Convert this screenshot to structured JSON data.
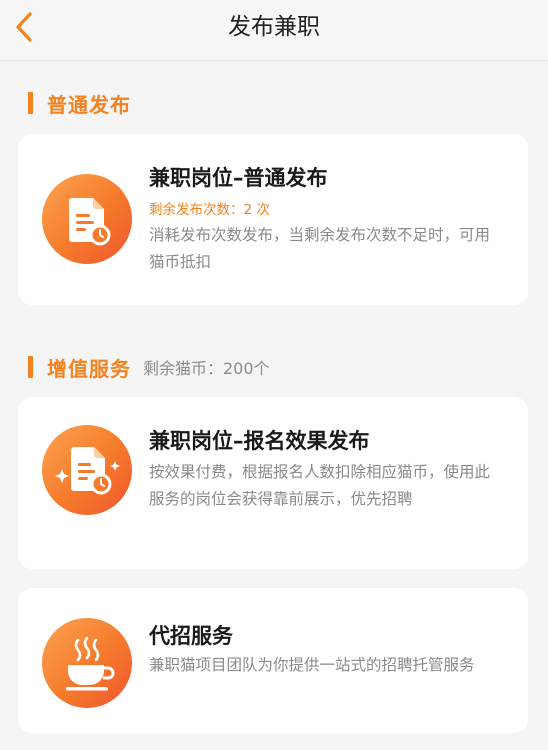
{
  "header": {
    "title": "发布兼职"
  },
  "normal_section": {
    "title": "普通发布"
  },
  "normal_card": {
    "title": "兼职岗位–普通发布",
    "quota": "剩余发布次数：2 次",
    "description": "消耗发布次数发布，当剩余发布次数不足时，可用猫币抵扣"
  },
  "value_section": {
    "title": "增值服务",
    "balance": "剩余猫币：200个"
  },
  "effect_card": {
    "title": "兼职岗位–报名效果发布",
    "description": "按效果付费，根据报名人数扣除相应猫币，使用此服务的岗位会获得靠前展示，优先招聘"
  },
  "agency_card": {
    "title": "代招服务",
    "description": "兼职猫项目团队为你提供一站式的招聘托管服务"
  },
  "colors": {
    "accent": "#f5821f",
    "background": "#f5f5f5",
    "card": "#ffffff"
  }
}
